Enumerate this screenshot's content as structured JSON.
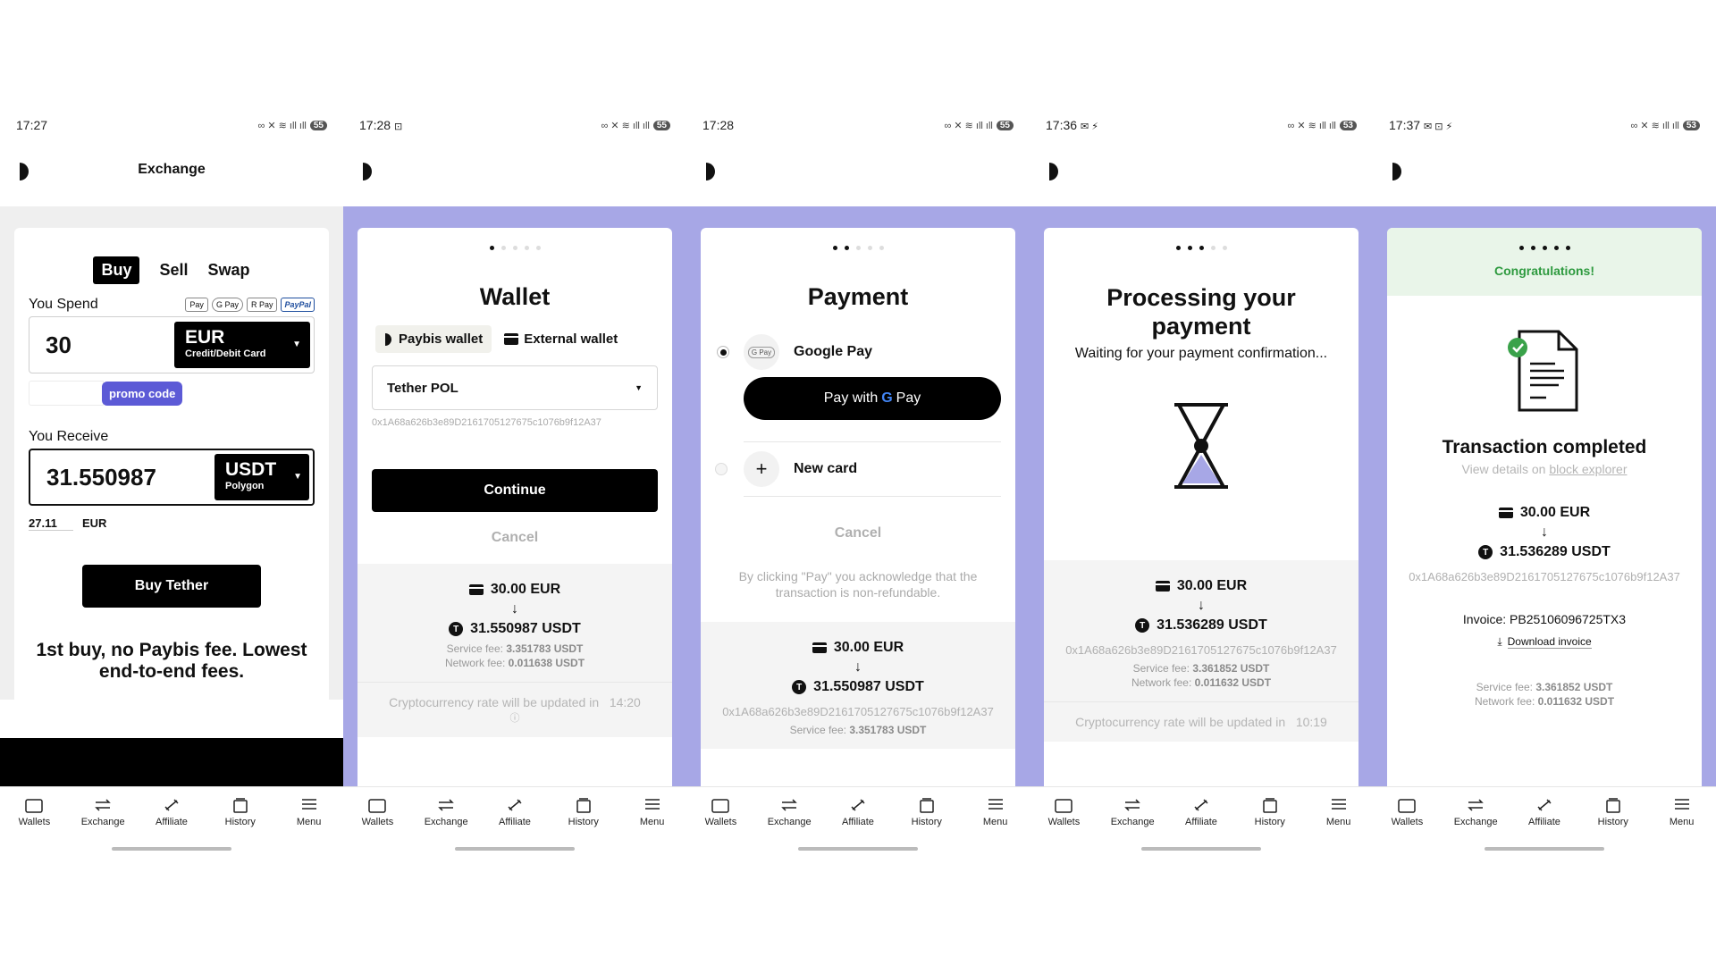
{
  "colors": {
    "accent": "#a7a7e6",
    "promo": "#5c5ad6",
    "success_bg": "#e9f5e9",
    "success_text": "#2e9a3f"
  },
  "nav": [
    "Wallets",
    "Exchange",
    "Affiliate",
    "History",
    "Menu"
  ],
  "screens": {
    "s1": {
      "time": "17:27",
      "battery": "55",
      "title": "Exchange",
      "tabs": {
        "buy": "Buy",
        "sell": "Sell",
        "swap": "Swap"
      },
      "you_spend": "You Spend",
      "pay_methods": [
        "Pay",
        "G Pay",
        "R Pay",
        "PayPal"
      ],
      "spend_amount": "30",
      "spend_currency": "EUR",
      "spend_method": "Credit/Debit Card",
      "promo_label": "promo code",
      "you_receive": "You Receive",
      "receive_amount": "31.550987",
      "receive_currency": "USDT",
      "receive_network": "Polygon",
      "rate_value": "27.11",
      "rate_currency": "EUR",
      "buy_button": "Buy Tether",
      "promo_text": "1st buy, no Paybis fee. Lowest end-to-end fees."
    },
    "s2": {
      "time": "17:28",
      "battery": "55",
      "title": "Wallet",
      "tab_paybis": "Paybis wallet",
      "tab_external": "External wallet",
      "select_value": "Tether POL",
      "address": "0x1A68a626b3e89D2161705127675c1076b9f12A37",
      "continue": "Continue",
      "cancel": "Cancel",
      "sum_eur": "30.00 EUR",
      "sum_usdt": "31.550987 USDT",
      "service_fee_label": "Service fee:",
      "service_fee": "3.351783 USDT",
      "network_fee_label": "Network fee:",
      "network_fee": "0.011638 USDT",
      "rate_text": "Cryptocurrency rate will be updated in",
      "rate_timer": "14:20"
    },
    "s3": {
      "time": "17:28",
      "battery": "55",
      "title": "Payment",
      "gpay_option": "Google Pay",
      "gpay_badge": "G Pay",
      "gpay_button_prefix": "Pay with",
      "gpay_button_brand": "Pay",
      "new_card": "New card",
      "cancel": "Cancel",
      "disclaimer": "By clicking \"Pay\" you acknowledge that the transaction is non-refundable.",
      "sum_eur": "30.00 EUR",
      "sum_usdt": "31.550987 USDT",
      "address": "0x1A68a626b3e89D2161705127675c1076b9f12A37",
      "service_fee_label": "Service fee:",
      "service_fee": "3.351783 USDT"
    },
    "s4": {
      "time": "17:36",
      "battery": "53",
      "title": "Processing your payment",
      "subtitle": "Waiting for your payment confirmation...",
      "sum_eur": "30.00 EUR",
      "sum_usdt": "31.536289 USDT",
      "address": "0x1A68a626b3e89D2161705127675c1076b9f12A37",
      "service_fee_label": "Service fee:",
      "service_fee": "3.361852 USDT",
      "network_fee_label": "Network fee:",
      "network_fee": "0.011632 USDT",
      "rate_text": "Cryptocurrency rate will be updated in",
      "rate_timer": "10:19"
    },
    "s5": {
      "time": "17:37",
      "battery": "53",
      "banner": "Congratulations!",
      "title": "Transaction completed",
      "view_prefix": "View details on",
      "view_link": "block explorer",
      "sum_eur": "30.00 EUR",
      "sum_usdt": "31.536289 USDT",
      "address": "0x1A68a626b3e89D2161705127675c1076b9f12A37",
      "invoice": "Invoice: PB25106096725TX3",
      "download": "Download invoice",
      "service_fee_label": "Service fee:",
      "service_fee": "3.361852 USDT",
      "network_fee_label": "Network fee:",
      "network_fee": "0.011632 USDT"
    }
  }
}
